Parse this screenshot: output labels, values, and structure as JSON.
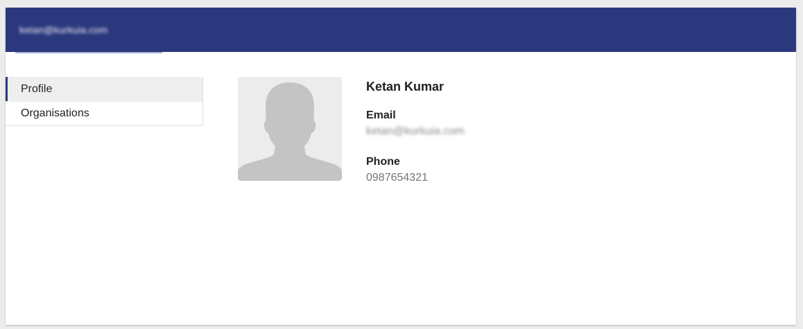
{
  "header": {
    "tab_label": "ketan@kurkuia.com",
    "background_color": "#2c387e",
    "indicator_color": "#a6acd6"
  },
  "sidebar": {
    "items": [
      {
        "label": "Profile",
        "active": true
      },
      {
        "label": "Organisations",
        "active": false
      }
    ]
  },
  "profile": {
    "avatar_icon": "person-silhouette-icon",
    "name": "Ketan Kumar",
    "email_label": "Email",
    "email_value": "ketan@kurkuia.com",
    "phone_label": "Phone",
    "phone_value": "0987654321"
  }
}
